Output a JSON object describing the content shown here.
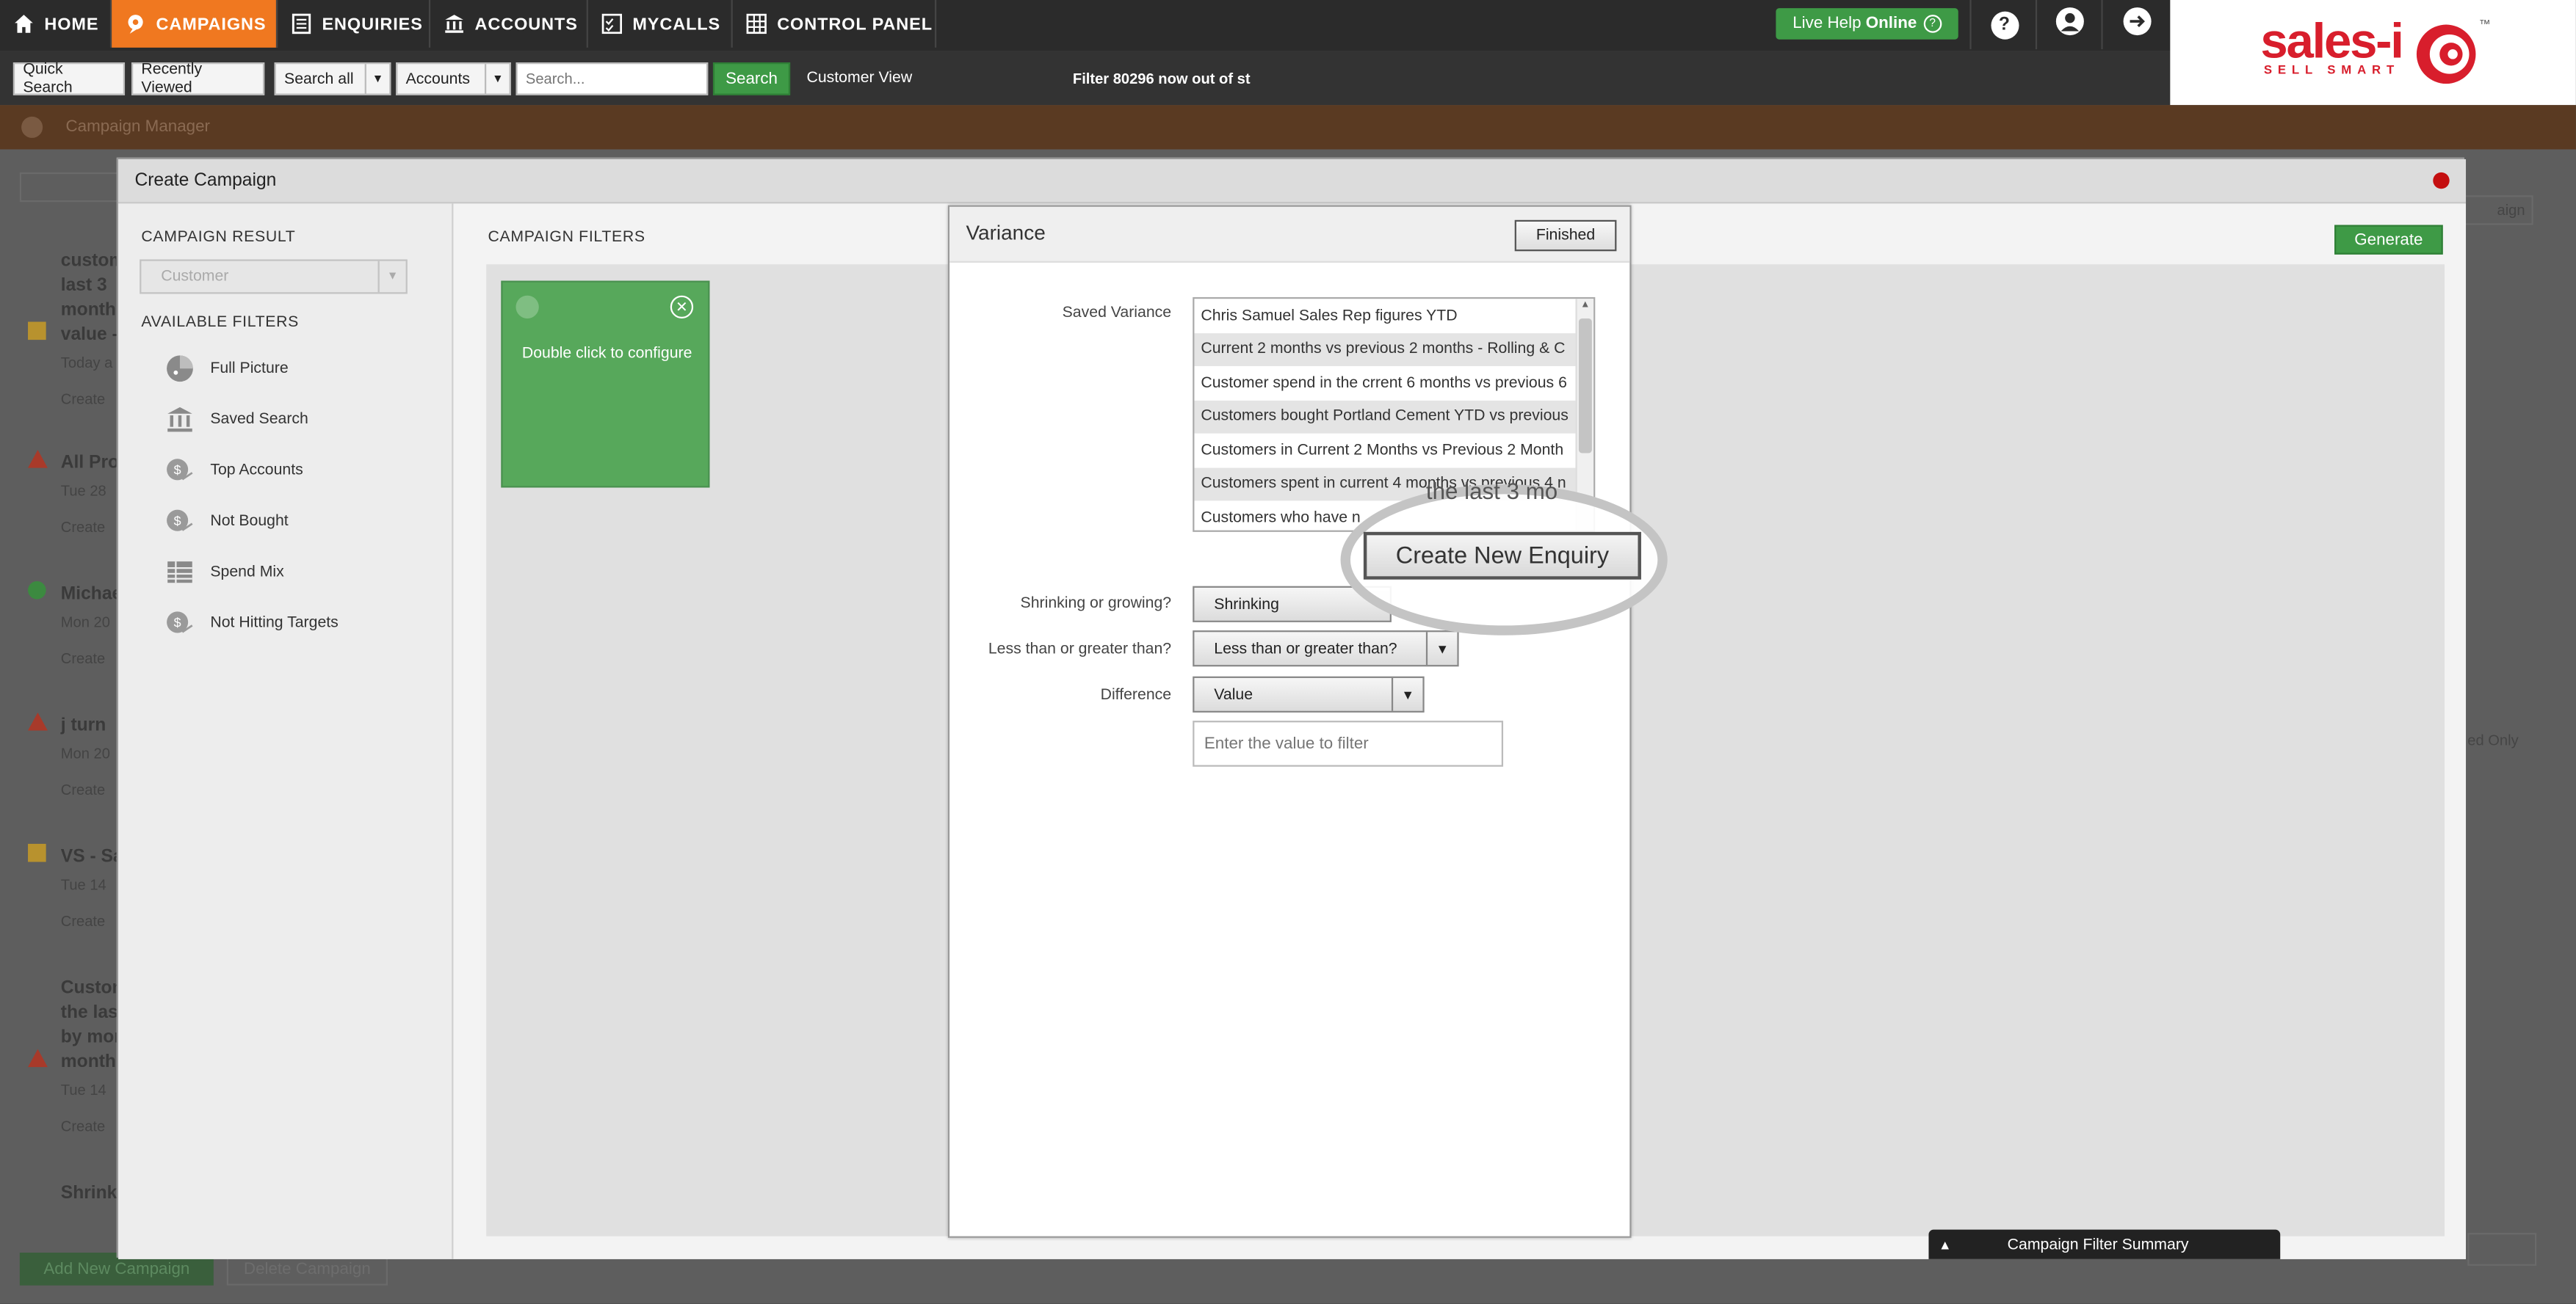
{
  "nav": {
    "items": [
      {
        "label": "HOME"
      },
      {
        "label": "CAMPAIGNS"
      },
      {
        "label": "ENQUIRIES"
      },
      {
        "label": "ACCOUNTS"
      },
      {
        "label": "MYCALLS"
      },
      {
        "label": "CONTROL PANEL"
      }
    ],
    "live_help_prefix": "Live Help ",
    "live_help_status": "Online"
  },
  "toolbar": {
    "quick_search": "Quick Search",
    "recently_viewed": "Recently Viewed",
    "search_all": "Search all",
    "accounts": "Accounts",
    "search_placeholder": "Search...",
    "search_button": "Search",
    "customer_view": "Customer View",
    "ticker": "Filter 80296 now out of st"
  },
  "logo": {
    "text": "sales-i",
    "tagline": "SELL SMART",
    "tm": "™"
  },
  "background": {
    "breadcrumb": "Campaign Manager",
    "items": [
      {
        "lines": [
          "custom",
          "last 3",
          "month",
          "value -"
        ],
        "meta": "Today a",
        "created": "Create",
        "status_color": "#b8922e"
      },
      {
        "lines": [
          "All Pro"
        ],
        "meta": "Tue 28",
        "created": "Create",
        "status_color": "#a83a2a"
      },
      {
        "lines": [
          "Michae"
        ],
        "meta": "Mon 20",
        "created": "Create",
        "status_color": "#3c8a40"
      },
      {
        "lines": [
          "j turn"
        ],
        "meta": "Mon 20",
        "created": "Create",
        "status_color": "#a83a2a"
      },
      {
        "lines": [
          "VS - Sa"
        ],
        "meta": "Tue 14",
        "created": "Create",
        "status_color": "#b8922e"
      },
      {
        "lines": [
          "Custom",
          "the las",
          "by mon",
          "month"
        ],
        "meta": "Tue 14",
        "created": "Create",
        "status_color": "#a83a2a"
      },
      {
        "lines": [
          "Shrink"
        ],
        "meta": "",
        "created": "",
        "status_color": ""
      }
    ],
    "add_button": "Add New Campaign",
    "delete_button": "Delete Campaign",
    "right_button_1": "aign",
    "right_label": "ed Only"
  },
  "dialog": {
    "title": "Create Campaign",
    "campaign_result_title": "CAMPAIGN RESULT",
    "result_value": "Customer",
    "available_filters_title": "AVAILABLE FILTERS",
    "filters": [
      {
        "label": "Full Picture",
        "icon": "pie-chart-icon"
      },
      {
        "label": "Saved Search",
        "icon": "bank-icon"
      },
      {
        "label": "Top Accounts",
        "icon": "money-bag-icon"
      },
      {
        "label": "Not Bought",
        "icon": "money-bag-icon"
      },
      {
        "label": "Spend Mix",
        "icon": "table-icon"
      },
      {
        "label": "Not Hitting Targets",
        "icon": "money-bag-icon"
      }
    ],
    "campaign_filters_title": "CAMPAIGN FILTERS",
    "card_text": "Double click to configure",
    "generate_button": "Generate",
    "summary_bar": "Campaign Filter Summary"
  },
  "variance": {
    "title": "Variance",
    "finished_button": "Finished",
    "saved_label": "Saved Variance",
    "saved_items": [
      "Chris Samuel Sales Rep figures YTD",
      "Current 2 months vs previous 2 months - Rolling & C",
      "Customer spend in the crrent 6 months vs previous 6",
      "Customers bought Portland Cement YTD vs previous",
      "Customers in Current 2 Months vs Previous 2 Month",
      "Customers spent in current 4 months vs previous 4 n",
      "Customers who have n"
    ],
    "overlay_fragment": "the last 3 mo",
    "create_enquiry_button": "Create New Enquiry",
    "shrinking_label": "Shrinking or growing?",
    "shrinking_value": "Shrinking",
    "less_greater_label": "Less than or greater than?",
    "less_greater_value": "Less than or greater than?",
    "difference_label": "Difference",
    "difference_value": "Value",
    "value_placeholder": "Enter the value to filter"
  },
  "colors": {
    "nav_active": "#f07820",
    "green": "#3e9a46",
    "card_green": "#57a85b",
    "brand_red": "#d81e2c"
  }
}
